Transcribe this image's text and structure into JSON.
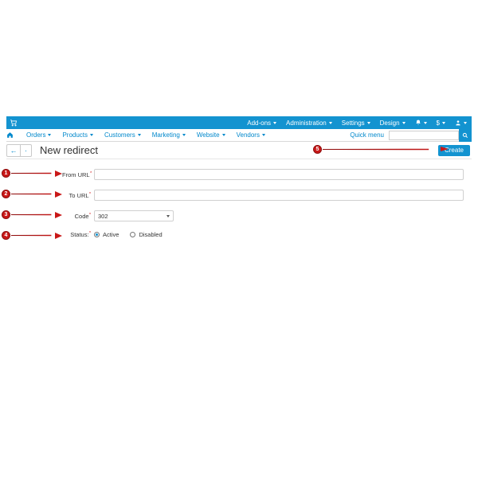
{
  "colors": {
    "primary": "#1393d0",
    "link": "#0088cc",
    "annotation": "#c91818"
  },
  "topbar": {
    "items": [
      {
        "label": "Add-ons"
      },
      {
        "label": "Administration"
      },
      {
        "label": "Settings"
      },
      {
        "label": "Design"
      }
    ],
    "icons": [
      "bell-icon",
      "currency-icon",
      "user-icon"
    ],
    "currency_symbol": "$"
  },
  "mainnav": {
    "items": [
      {
        "label": "Orders"
      },
      {
        "label": "Products"
      },
      {
        "label": "Customers"
      },
      {
        "label": "Marketing"
      },
      {
        "label": "Website"
      },
      {
        "label": "Vendors"
      }
    ],
    "quick_menu_label": "Quick menu",
    "search_placeholder": ""
  },
  "page": {
    "title": "New redirect",
    "back_symbol": "←",
    "more_symbol": "·",
    "create_label": "Create"
  },
  "form": {
    "from_url": {
      "label": "From URL",
      "value": ""
    },
    "to_url": {
      "label": "To URL",
      "value": ""
    },
    "code": {
      "label": "Code",
      "value": "302"
    },
    "status": {
      "label": "Status:",
      "active_label": "Active",
      "disabled_label": "Disabled",
      "value": "Active"
    }
  },
  "annotations": {
    "1": "From URL field",
    "2": "To URL field",
    "3": "Code select",
    "4": "Status radios",
    "5": "Create button"
  }
}
